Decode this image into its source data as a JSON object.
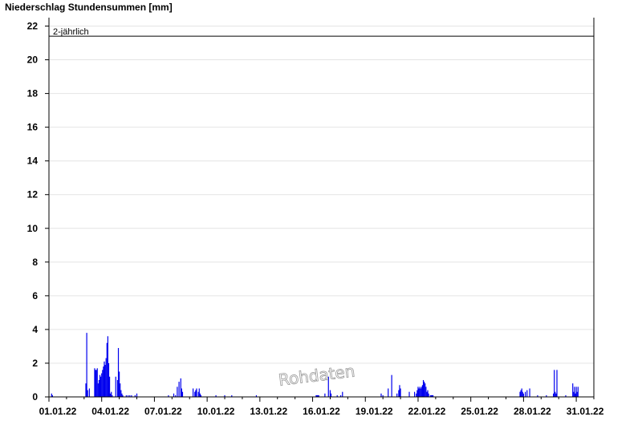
{
  "chart_data": {
    "type": "bar",
    "title": "Niederschlag Stundensummen [mm]",
    "xlabel": "",
    "ylabel": "",
    "ylim": [
      0,
      22.5
    ],
    "yticks": [
      0,
      2,
      4,
      6,
      8,
      10,
      12,
      14,
      16,
      18,
      20,
      22
    ],
    "grid": true,
    "x_range_days": [
      0,
      31
    ],
    "xtick_labels": [
      "01.01.22",
      "04.01.22",
      "07.01.22",
      "10.01.22",
      "13.01.22",
      "16.01.22",
      "19.01.22",
      "22.01.22",
      "25.01.22",
      "28.01.22",
      "31.01.22"
    ],
    "reference_line": {
      "label": "2-jährlich",
      "value": 21.4
    },
    "watermark": "Rohdaten",
    "series_color": "#0000ee",
    "series": [
      {
        "x": [
          0.15,
          0.2,
          2.1,
          2.15,
          2.2,
          2.3,
          2.6,
          2.65,
          2.7,
          2.75,
          2.8,
          2.85,
          2.9,
          2.95,
          3.0,
          3.05,
          3.1,
          3.15,
          3.2,
          3.25,
          3.3,
          3.35,
          3.4,
          3.45,
          3.5,
          3.55,
          3.6,
          3.8,
          3.9,
          3.95,
          4.0,
          4.05,
          4.1,
          4.15,
          4.2,
          4.4,
          4.5,
          4.6,
          4.7,
          4.9,
          5.0,
          6.8,
          7.1,
          7.2,
          7.3,
          7.4,
          7.5,
          7.55,
          7.6,
          8.2,
          8.3,
          8.35,
          8.4,
          8.5,
          8.55,
          8.6,
          8.65,
          9.5,
          10.0,
          10.4,
          11.8,
          15.2,
          15.25,
          15.3,
          15.35,
          15.7,
          15.9,
          16.0,
          16.05,
          16.4,
          16.6,
          16.7,
          18.9,
          19.0,
          19.3,
          19.5,
          19.8,
          19.9,
          19.95,
          20.0,
          20.5,
          20.8,
          20.9,
          20.95,
          21.0,
          21.05,
          21.1,
          21.15,
          21.2,
          21.25,
          21.3,
          21.35,
          21.4,
          21.45,
          21.5,
          21.55,
          21.6,
          21.7,
          21.75,
          21.8,
          21.85,
          26.8,
          26.85,
          26.9,
          26.95,
          27.0,
          27.1,
          27.2,
          27.35,
          27.8,
          28.3,
          28.7,
          28.75,
          28.8,
          28.85,
          28.9,
          29.4,
          29.8,
          29.85,
          29.9,
          29.95,
          30.0,
          30.05,
          30.1
        ],
        "values": [
          0.2,
          0.1,
          0.8,
          3.8,
          0.4,
          0.5,
          1.7,
          1.6,
          1.6,
          1.7,
          0.8,
          1.0,
          1.3,
          1.2,
          1.4,
          1.6,
          1.8,
          2.1,
          1.9,
          2.3,
          3.2,
          3.6,
          2.0,
          1.2,
          0.2,
          0.3,
          0.1,
          1.2,
          1.0,
          2.9,
          1.5,
          0.8,
          0.4,
          0.2,
          0.1,
          0.1,
          0.1,
          0.1,
          0.1,
          0.1,
          0.2,
          0.1,
          0.2,
          0.1,
          0.6,
          0.9,
          1.1,
          0.5,
          0.3,
          0.5,
          0.3,
          0.4,
          0.5,
          0.3,
          0.5,
          0.2,
          0.1,
          0.1,
          0.1,
          0.1,
          0.1,
          0.1,
          0.1,
          0.1,
          0.1,
          0.2,
          1.2,
          0.4,
          0.2,
          0.1,
          0.1,
          0.3,
          0.2,
          0.1,
          0.5,
          1.3,
          0.2,
          0.4,
          0.7,
          0.5,
          0.3,
          0.3,
          0.2,
          0.4,
          0.6,
          0.5,
          0.6,
          0.5,
          0.6,
          0.7,
          1.0,
          0.9,
          0.8,
          0.6,
          0.3,
          0.4,
          0.2,
          0.1,
          0.1,
          0.1,
          0.1,
          0.3,
          0.4,
          0.5,
          0.3,
          0.2,
          0.3,
          0.4,
          0.5,
          0.1,
          0.1,
          0.2,
          1.6,
          0.3,
          0.2,
          1.6,
          0.1,
          0.8,
          0.3,
          0.6,
          0.2,
          0.6,
          0.3,
          0.6
        ]
      }
    ]
  }
}
